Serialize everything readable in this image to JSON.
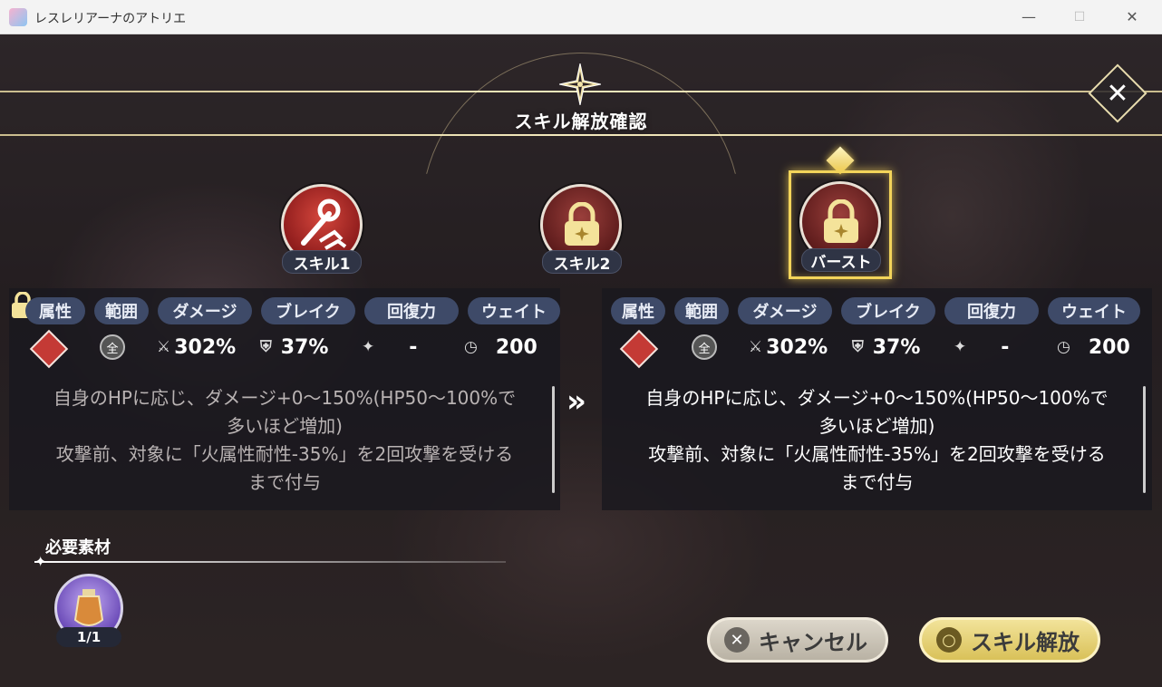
{
  "window": {
    "title": "レスレリアーナのアトリエ",
    "minimize": "—",
    "maximize": "☐",
    "close": "✕"
  },
  "dialog": {
    "title": "スキル解放確認"
  },
  "skills": [
    {
      "label": "スキル1",
      "locked": false
    },
    {
      "label": "スキル2",
      "locked": true
    },
    {
      "label": "バースト",
      "locked": true,
      "selected": true
    }
  ],
  "tags": [
    "属性",
    "範囲",
    "ダメージ",
    "ブレイク",
    "回復力",
    "ウェイト"
  ],
  "before": {
    "range": "全",
    "damage": "302%",
    "break": "37%",
    "heal": "-",
    "wait": "200",
    "desc": [
      "自身のHPに応じ、ダメージ+0～150%(HP50～100%で",
      "多いほど増加)",
      "攻撃前、対象に「火属性耐性-35%」を2回攻撃を受ける",
      "まで付与"
    ]
  },
  "after": {
    "range": "全",
    "damage": "302%",
    "break": "37%",
    "heal": "-",
    "wait": "200",
    "desc": [
      "自身のHPに応じ、ダメージ+0～150%(HP50～100%で",
      "多いほど増加)",
      "攻撃前、対象に「火属性耐性-35%」を2回攻撃を受ける",
      "まで付与"
    ]
  },
  "arrow": "»",
  "materials": {
    "title": "必要素材",
    "count": "1/1"
  },
  "buttons": {
    "cancel": "キャンセル",
    "cancel_icon": "✕",
    "confirm": "スキル解放",
    "confirm_icon": "○"
  },
  "colors": {
    "accent": "#f3d45a",
    "tag": "#3e4a68",
    "fire": "#c43a35"
  }
}
